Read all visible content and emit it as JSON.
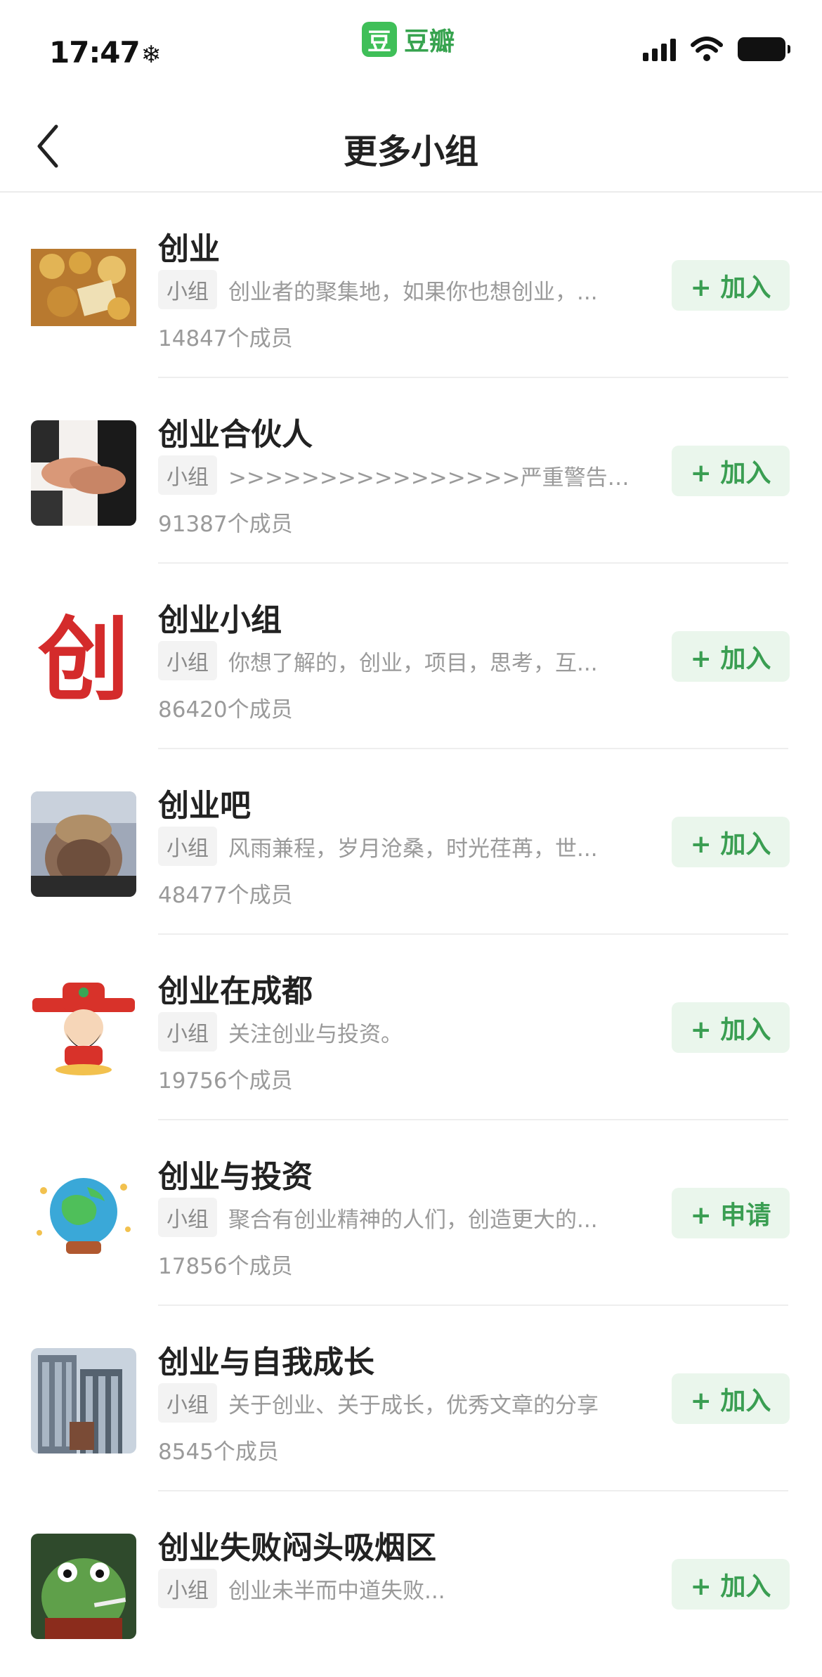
{
  "status_bar": {
    "time": "17:47",
    "snow_glyph": "❄",
    "app_logo_char": "豆",
    "app_name": "豆瓣"
  },
  "nav": {
    "title": "更多小组"
  },
  "groups": [
    {
      "name": "创业",
      "tag": "小组",
      "desc": "创业者的聚集地，如果你也想创业，...",
      "members": "14847个成员",
      "action": "+ 加入",
      "avatar": "gold-coins-avatar"
    },
    {
      "name": "创业合伙人",
      "tag": "小组",
      "desc": ">>>>>>>>>>>>>>>>严重警告<<<<<<...",
      "members": "91387个成员",
      "action": "+ 加入",
      "avatar": "handshake-avatar"
    },
    {
      "name": "创业小组",
      "tag": "小组",
      "desc": "你想了解的，创业，项目，思考，互...",
      "members": "86420个成员",
      "action": "+ 加入",
      "avatar": "chuang-character-avatar",
      "avatar_char": "创"
    },
    {
      "name": "创业吧",
      "tag": "小组",
      "desc": "风雨兼程，岁月沧桑，时光荏苒，世...",
      "members": "48477个成员",
      "action": "+ 加入",
      "avatar": "clasped-hands-avatar"
    },
    {
      "name": "创业在成都",
      "tag": "小组",
      "desc": "关注创业与投资。",
      "members": "19756个成员",
      "action": "+ 加入",
      "avatar": "fortune-god-avatar"
    },
    {
      "name": "创业与投资",
      "tag": "小组",
      "desc": "聚合有创业精神的人们，创造更大的...",
      "members": "17856个成员",
      "action": "+ 申请",
      "avatar": "crystal-globe-avatar"
    },
    {
      "name": "创业与自我成长",
      "tag": "小组",
      "desc": "关于创业、关于成长，优秀文章的分享",
      "members": "8545个成员",
      "action": "+ 加入",
      "avatar": "skyscraper-avatar"
    },
    {
      "name": "创业失败闷头吸烟区",
      "tag": "小组",
      "desc": "创业未半而中道失败...",
      "members": "",
      "action": "+ 加入",
      "avatar": "frog-smoking-avatar"
    }
  ]
}
